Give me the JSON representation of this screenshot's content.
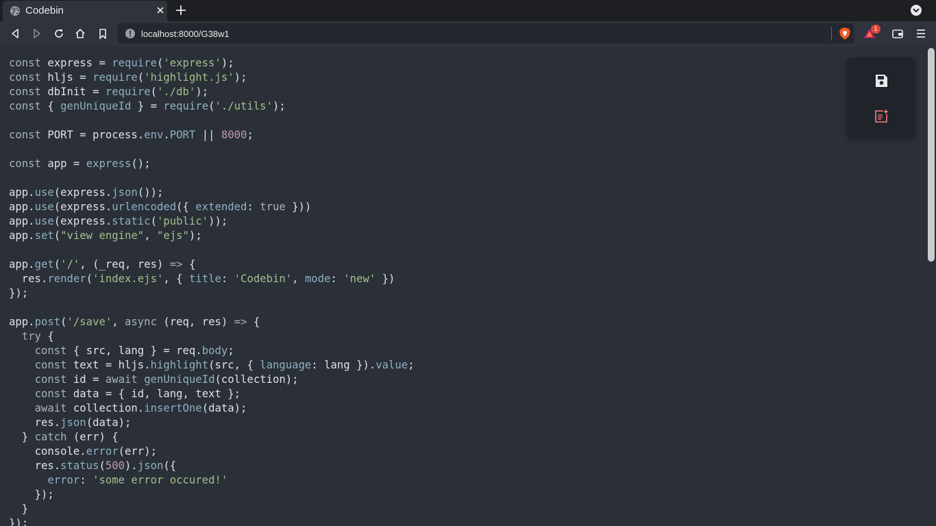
{
  "browser": {
    "tab": {
      "title": "Codebin"
    },
    "address": {
      "url": "localhost:8000/G38w1"
    },
    "rewards_badge": "1",
    "colors": {
      "tab_bg": "#2f333b",
      "strip_bg": "#1d1f23",
      "urlbar_bg": "#24272d",
      "brave_orange": "#f15a22"
    }
  },
  "editor": {
    "language": "javascript",
    "colors": {
      "background": "#2a2f38",
      "keyword": "#a8b2bd",
      "string": "#a3c08b",
      "number": "#c29ab2",
      "function": "#8fb1c2"
    },
    "lines": [
      "const express = require('express');",
      "const hljs = require('highlight.js');",
      "const dbInit = require('./db');",
      "const { genUniqueId } = require('./utils');",
      "",
      "const PORT = process.env.PORT || 8000;",
      "",
      "const app = express();",
      "",
      "app.use(express.json());",
      "app.use(express.urlencoded({ extended: true }))",
      "app.use(express.static('public'));",
      "app.set(\"view engine\", \"ejs\");",
      "",
      "app.get('/', (_req, res) => {",
      "  res.render('index.ejs', { title: 'Codebin', mode: 'new' })",
      "});",
      "",
      "app.post('/save', async (req, res) => {",
      "  try {",
      "    const { src, lang } = req.body;",
      "    const text = hljs.highlight(src, { language: lang }).value;",
      "    const id = await genUniqueId(collection);",
      "    const data = { id, lang, text };",
      "    await collection.insertOne(data);",
      "    res.json(data);",
      "  } catch (err) {",
      "    console.error(err);",
      "    res.status(500).json({",
      "      error: 'some error occured!'",
      "    });",
      "  }",
      "});"
    ]
  },
  "actions": {
    "save_icon": "floppy-disk-icon",
    "new_icon": "new-note-icon"
  }
}
